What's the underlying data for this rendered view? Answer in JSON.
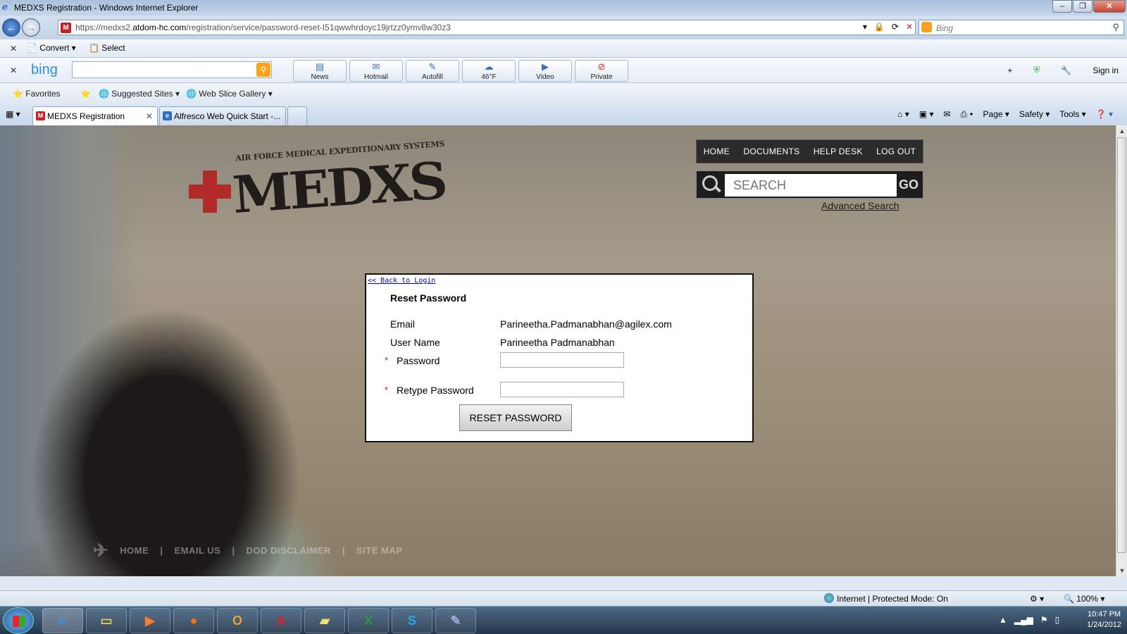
{
  "window": {
    "title": "MEDXS Registration - Windows Internet Explorer"
  },
  "address": {
    "url_prefix": "https://medxs2.",
    "url_domain": "atdom-hc.com",
    "url_path": "/registration/service/password-reset-I51qwwhrdoyc19jrtzz0ymv8w30z3"
  },
  "search": {
    "placeholder": "Bing"
  },
  "command_bar": {
    "convert": "Convert",
    "select": "Select"
  },
  "bing_bar": {
    "logo": "bing",
    "buttons": [
      {
        "label": "News"
      },
      {
        "label": "Hotmail"
      },
      {
        "label": "Autofill"
      },
      {
        "label": "46°F"
      },
      {
        "label": "Video"
      },
      {
        "label": "Private"
      }
    ],
    "sign_in": "Sign in"
  },
  "favorites": {
    "favorites": "Favorites",
    "suggested": "Suggested Sites",
    "gallery": "Web Slice Gallery"
  },
  "tabs": [
    {
      "label": "MEDXS Registration"
    },
    {
      "label": "Alfresco Web Quick Start -..."
    }
  ],
  "ie_tools": {
    "page": "Page",
    "safety": "Safety",
    "tools": "Tools"
  },
  "site": {
    "logo_sub": "AIR FORCE MEDICAL EXPEDITIONARY SYSTEMS",
    "logo_main": "MEDXS",
    "nav": [
      "HOME",
      "DOCUMENTS",
      "HELP DESK",
      "LOG OUT"
    ],
    "search_placeholder": "SEARCH",
    "search_go": "GO",
    "advanced_search": "Advanced Search",
    "footer": [
      "HOME",
      "EMAIL US",
      "DOD DISCLAIMER",
      "SITE MAP"
    ]
  },
  "form": {
    "back_link": "<< Back to Login",
    "title": "Reset Password",
    "email_label": "Email",
    "email_value": "Parineetha.Padmanabhan@agilex.com",
    "username_label": "User Name",
    "username_value": "Parineetha Padmanabhan",
    "password_label": "Password",
    "retype_label": "Retype Password",
    "required_mark": "*",
    "submit": "RESET PASSWORD"
  },
  "status": {
    "zone": "Internet | Protected Mode: On",
    "zoom": "100%"
  },
  "clock": {
    "time": "10:47 PM",
    "date": "1/24/2012"
  }
}
